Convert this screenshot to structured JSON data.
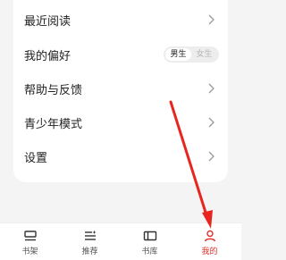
{
  "menu": {
    "items": [
      {
        "label": "最近阅读"
      },
      {
        "label": "我的偏好",
        "toggle": {
          "options": [
            "男生",
            "女生"
          ],
          "selected": "男生"
        }
      },
      {
        "label": "帮助与反馈"
      },
      {
        "label": "青少年模式"
      },
      {
        "label": "设置"
      }
    ]
  },
  "tabbar": {
    "tabs": [
      {
        "label": "书架",
        "icon": "bookshelf-icon"
      },
      {
        "label": "推荐",
        "icon": "recommend-icon"
      },
      {
        "label": "书库",
        "icon": "library-icon"
      },
      {
        "label": "我的",
        "icon": "profile-icon",
        "active": true
      }
    ]
  },
  "colors": {
    "accent": "#e0302a",
    "annotation_arrow": "#e8261f",
    "background": "#f4f4f4"
  }
}
